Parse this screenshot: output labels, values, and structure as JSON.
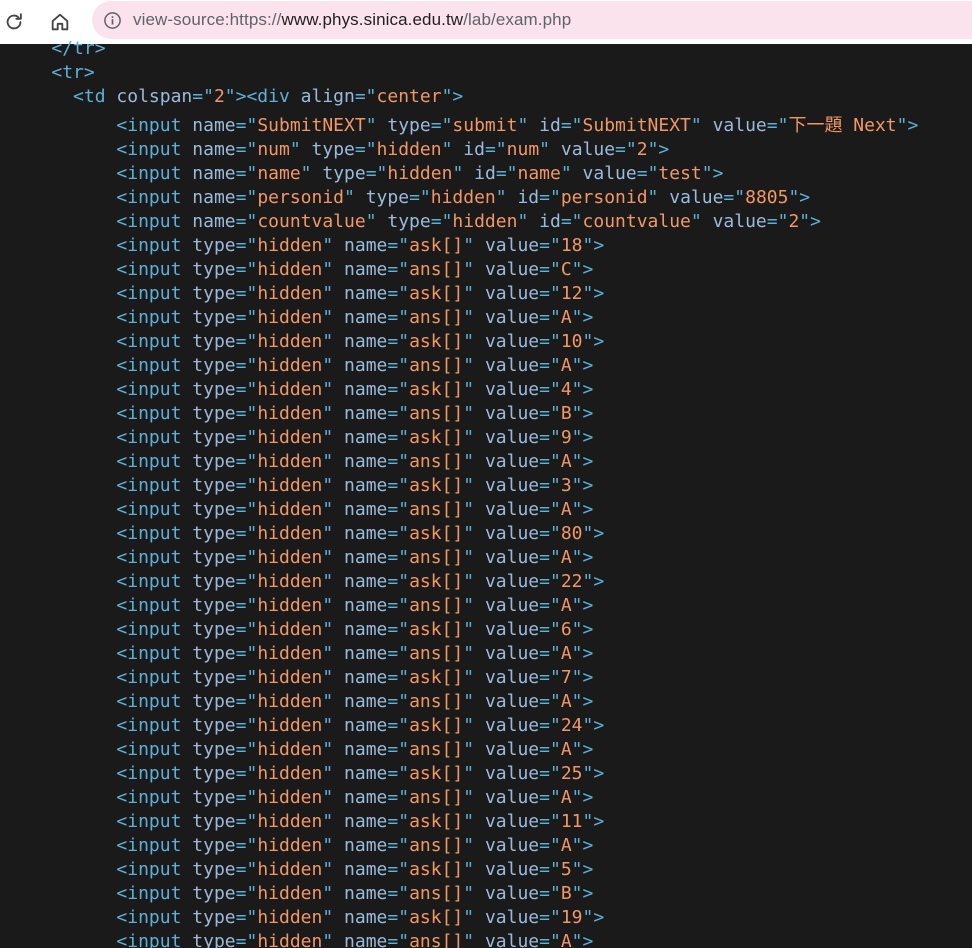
{
  "browser": {
    "url_prefix": "view-source:https://",
    "url_domain": "www.phys.sinica.edu.tw",
    "url_path": "/lab/exam.php"
  },
  "source_lines": [
    {
      "indent": 4,
      "tokens": [
        {
          "c": "tag",
          "t": "</tr>"
        }
      ]
    },
    {
      "indent": 4,
      "tokens": [
        {
          "c": "tag",
          "t": "<tr>"
        }
      ]
    },
    {
      "indent": 6,
      "tokens": [
        {
          "c": "tag",
          "t": "<td "
        },
        {
          "c": "attr",
          "t": "colspan"
        },
        {
          "c": "tag",
          "t": "=\""
        },
        {
          "c": "val",
          "t": "2"
        },
        {
          "c": "tag",
          "t": "\"><div "
        },
        {
          "c": "attr",
          "t": "align"
        },
        {
          "c": "tag",
          "t": "=\""
        },
        {
          "c": "val",
          "t": "center"
        },
        {
          "c": "tag",
          "t": "\">"
        }
      ]
    },
    {
      "indent": 10,
      "tokens": [
        {
          "c": "tag",
          "t": "<input "
        },
        {
          "c": "attr",
          "t": "name"
        },
        {
          "c": "tag",
          "t": "=\""
        },
        {
          "c": "val",
          "t": "SubmitNEXT"
        },
        {
          "c": "tag",
          "t": "\" "
        },
        {
          "c": "attr",
          "t": "type"
        },
        {
          "c": "tag",
          "t": "=\""
        },
        {
          "c": "val",
          "t": "submit"
        },
        {
          "c": "tag",
          "t": "\" "
        },
        {
          "c": "attr",
          "t": "id"
        },
        {
          "c": "tag",
          "t": "=\""
        },
        {
          "c": "val",
          "t": "SubmitNEXT"
        },
        {
          "c": "tag",
          "t": "\" "
        },
        {
          "c": "attr",
          "t": "value"
        },
        {
          "c": "tag",
          "t": "=\""
        },
        {
          "c": "val",
          "t": "下一題 Next"
        },
        {
          "c": "tag",
          "t": "\">"
        }
      ]
    },
    {
      "indent": 10,
      "tokens": [
        {
          "c": "tag",
          "t": "<input "
        },
        {
          "c": "attr",
          "t": "name"
        },
        {
          "c": "tag",
          "t": "=\""
        },
        {
          "c": "val",
          "t": "num"
        },
        {
          "c": "tag",
          "t": "\" "
        },
        {
          "c": "attr",
          "t": "type"
        },
        {
          "c": "tag",
          "t": "=\""
        },
        {
          "c": "val",
          "t": "hidden"
        },
        {
          "c": "tag",
          "t": "\" "
        },
        {
          "c": "attr",
          "t": "id"
        },
        {
          "c": "tag",
          "t": "=\""
        },
        {
          "c": "val",
          "t": "num"
        },
        {
          "c": "tag",
          "t": "\" "
        },
        {
          "c": "attr",
          "t": "value"
        },
        {
          "c": "tag",
          "t": "=\""
        },
        {
          "c": "val",
          "t": "2"
        },
        {
          "c": "tag",
          "t": "\">"
        }
      ]
    },
    {
      "indent": 10,
      "tokens": [
        {
          "c": "tag",
          "t": "<input "
        },
        {
          "c": "attr",
          "t": "name"
        },
        {
          "c": "tag",
          "t": "=\""
        },
        {
          "c": "val",
          "t": "name"
        },
        {
          "c": "tag",
          "t": "\" "
        },
        {
          "c": "attr",
          "t": "type"
        },
        {
          "c": "tag",
          "t": "=\""
        },
        {
          "c": "val",
          "t": "hidden"
        },
        {
          "c": "tag",
          "t": "\" "
        },
        {
          "c": "attr",
          "t": "id"
        },
        {
          "c": "tag",
          "t": "=\""
        },
        {
          "c": "val",
          "t": "name"
        },
        {
          "c": "tag",
          "t": "\" "
        },
        {
          "c": "attr",
          "t": "value"
        },
        {
          "c": "tag",
          "t": "=\""
        },
        {
          "c": "val",
          "t": "test"
        },
        {
          "c": "tag",
          "t": "\">"
        }
      ]
    },
    {
      "indent": 10,
      "tokens": [
        {
          "c": "tag",
          "t": "<input "
        },
        {
          "c": "attr",
          "t": "name"
        },
        {
          "c": "tag",
          "t": "=\""
        },
        {
          "c": "val",
          "t": "personid"
        },
        {
          "c": "tag",
          "t": "\" "
        },
        {
          "c": "attr",
          "t": "type"
        },
        {
          "c": "tag",
          "t": "=\""
        },
        {
          "c": "val",
          "t": "hidden"
        },
        {
          "c": "tag",
          "t": "\" "
        },
        {
          "c": "attr",
          "t": "id"
        },
        {
          "c": "tag",
          "t": "=\""
        },
        {
          "c": "val",
          "t": "personid"
        },
        {
          "c": "tag",
          "t": "\" "
        },
        {
          "c": "attr",
          "t": "value"
        },
        {
          "c": "tag",
          "t": "=\""
        },
        {
          "c": "val",
          "t": "8805"
        },
        {
          "c": "tag",
          "t": "\">"
        }
      ]
    },
    {
      "indent": 10,
      "tokens": [
        {
          "c": "tag",
          "t": "<input "
        },
        {
          "c": "attr",
          "t": "name"
        },
        {
          "c": "tag",
          "t": "=\""
        },
        {
          "c": "val",
          "t": "countvalue"
        },
        {
          "c": "tag",
          "t": "\" "
        },
        {
          "c": "attr",
          "t": "type"
        },
        {
          "c": "tag",
          "t": "=\""
        },
        {
          "c": "val",
          "t": "hidden"
        },
        {
          "c": "tag",
          "t": "\" "
        },
        {
          "c": "attr",
          "t": "id"
        },
        {
          "c": "tag",
          "t": "=\""
        },
        {
          "c": "val",
          "t": "countvalue"
        },
        {
          "c": "tag",
          "t": "\" "
        },
        {
          "c": "attr",
          "t": "value"
        },
        {
          "c": "tag",
          "t": "=\""
        },
        {
          "c": "val",
          "t": "2"
        },
        {
          "c": "tag",
          "t": "\">"
        }
      ]
    }
  ],
  "hidden_inputs": [
    {
      "name": "ask[]",
      "value": "18"
    },
    {
      "name": "ans[]",
      "value": "C"
    },
    {
      "name": "ask[]",
      "value": "12"
    },
    {
      "name": "ans[]",
      "value": "A"
    },
    {
      "name": "ask[]",
      "value": "10"
    },
    {
      "name": "ans[]",
      "value": "A"
    },
    {
      "name": "ask[]",
      "value": "4"
    },
    {
      "name": "ans[]",
      "value": "B"
    },
    {
      "name": "ask[]",
      "value": "9"
    },
    {
      "name": "ans[]",
      "value": "A"
    },
    {
      "name": "ask[]",
      "value": "3"
    },
    {
      "name": "ans[]",
      "value": "A"
    },
    {
      "name": "ask[]",
      "value": "80"
    },
    {
      "name": "ans[]",
      "value": "A"
    },
    {
      "name": "ask[]",
      "value": "22"
    },
    {
      "name": "ans[]",
      "value": "A"
    },
    {
      "name": "ask[]",
      "value": "6"
    },
    {
      "name": "ans[]",
      "value": "A"
    },
    {
      "name": "ask[]",
      "value": "7"
    },
    {
      "name": "ans[]",
      "value": "A"
    },
    {
      "name": "ask[]",
      "value": "24"
    },
    {
      "name": "ans[]",
      "value": "A"
    },
    {
      "name": "ask[]",
      "value": "25"
    },
    {
      "name": "ans[]",
      "value": "A"
    },
    {
      "name": "ask[]",
      "value": "11"
    },
    {
      "name": "ans[]",
      "value": "A"
    },
    {
      "name": "ask[]",
      "value": "5"
    },
    {
      "name": "ans[]",
      "value": "B"
    },
    {
      "name": "ask[]",
      "value": "19"
    },
    {
      "name": "ans[]",
      "value": "A"
    }
  ],
  "colors": {
    "background": "#1a1a1a",
    "tag": "#5db0d7",
    "attribute": "#9bbbdc",
    "value": "#f29766",
    "omnibox": "#fbe3ee"
  },
  "icons": [
    "reload-icon",
    "home-icon",
    "info-icon"
  ]
}
